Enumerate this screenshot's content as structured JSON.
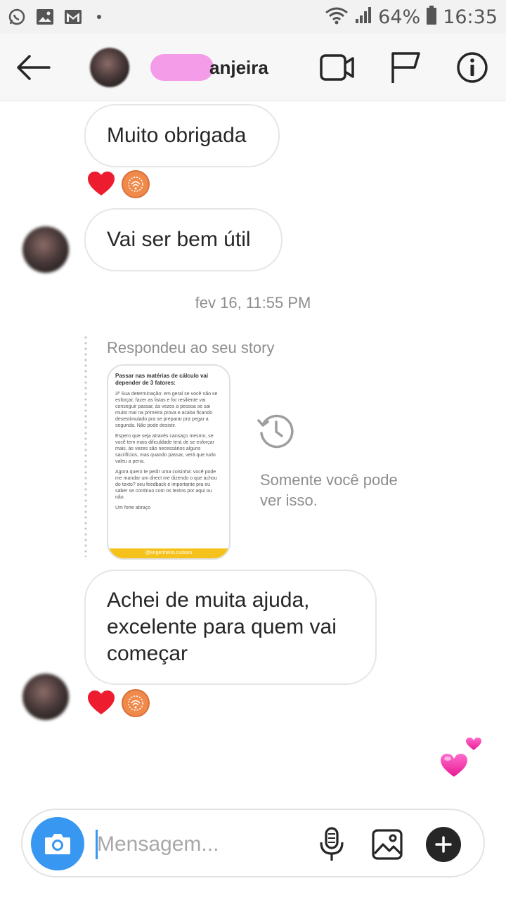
{
  "status_bar": {
    "battery": "64%",
    "time": "16:35",
    "icons": [
      "whatsapp-icon",
      "gallery-icon",
      "gmail-icon",
      "wifi-icon",
      "signal-icon",
      "battery-icon"
    ]
  },
  "header": {
    "contact_name_visible": "anjeira",
    "icons": [
      "back-arrow-icon",
      "video-call-icon",
      "flag-icon",
      "info-icon"
    ]
  },
  "messages": [
    {
      "text": "Muito obrigada",
      "reactions": [
        "heart",
        "sticker"
      ]
    },
    {
      "text": "Vai ser bem útil"
    },
    {
      "timestamp": "fev 16, 11:55 PM"
    },
    {
      "story_reply_label": "Respondeu ao seu story",
      "story_preview": {
        "title": "Passar nas matérias de cálculo vai depender de 3 fatores:",
        "para1": "3º Sua determinação: em geral se você não se esforçar, fazer as listas e for resiliente vai conseguir passar, às vezes a pessoa se sai muito mal na primeira prova e acaba ficando desestimulado pra se preparar pra pegar a segunda. Não pode desistir.",
        "para2": "Espero que seja através cansaço mesmo, se você tem mais dificuldade terá de se esforçar mais, às vezes são necessários alguns sacrifícios, mas quando passar, verá que tudo valeu a pena.",
        "para3": "Agora quero te pedir uma coisinha: você pode me mandar um direct me dizendo o que achou do texto? seu feedback é importante pra eu saber se continuo com os textos por aqui ou não.",
        "para4": "Um forte abraço",
        "footer": "@engenheiro.curioso"
      },
      "privacy_note": "Somente você pode ver isso."
    },
    {
      "text": "Achei de muita ajuda, excelente para quem vai começar",
      "reactions": [
        "heart",
        "sticker"
      ]
    }
  ],
  "composer": {
    "placeholder": "Mensagem...",
    "value": ""
  },
  "colors": {
    "accent": "#3897f0",
    "heart": "#ed1c2e",
    "sticker": "#f08a4b",
    "story_footer": "#f5c21b"
  }
}
